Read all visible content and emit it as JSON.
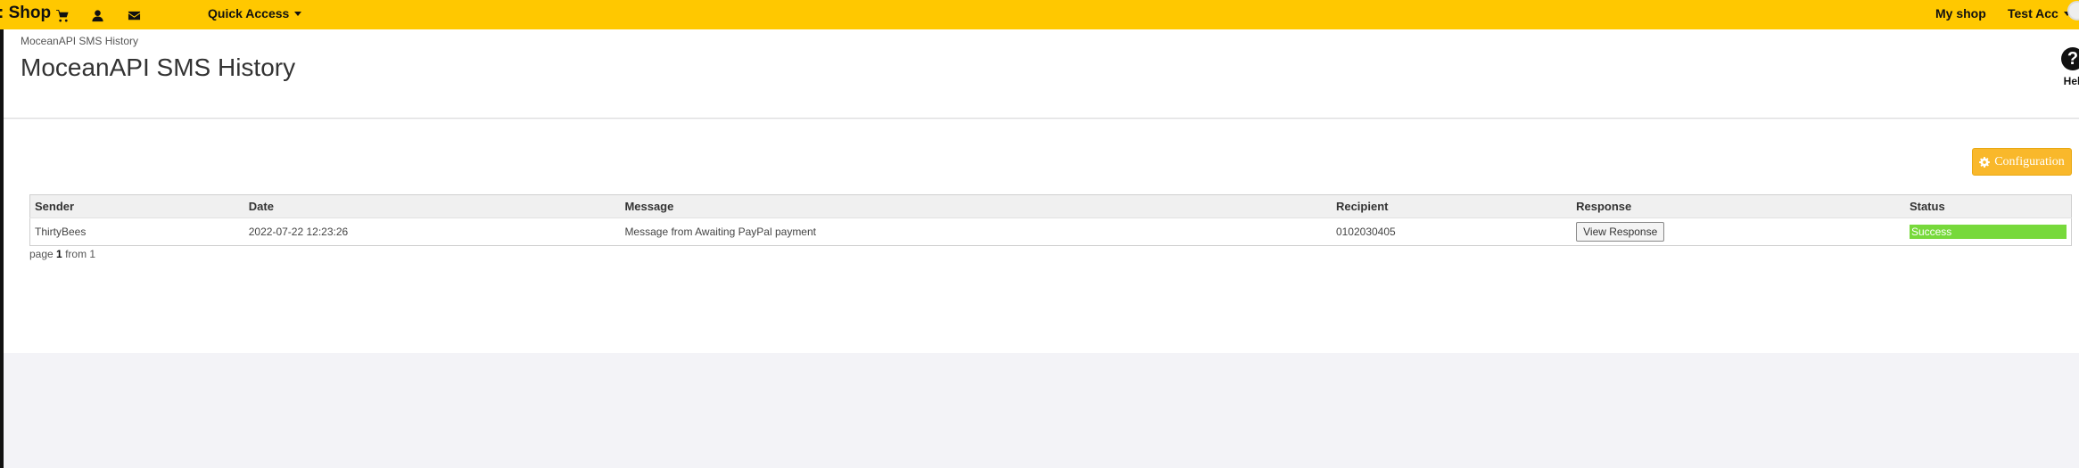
{
  "topbar": {
    "brand": ": Shop",
    "quick_access_label": "Quick Access",
    "my_shop_label": "My shop",
    "account_label": "Test Acc"
  },
  "icons": {
    "cart": "cart-icon",
    "user": "user-icon",
    "mail": "envelope-icon",
    "help": "question-circle-icon",
    "gear": "gear-icon"
  },
  "header": {
    "breadcrumb": "MoceanAPI SMS History",
    "title": "MoceanAPI SMS History",
    "help_label": "Hel",
    "help_glyph": "?"
  },
  "toolbar": {
    "configuration_label": "Configuration"
  },
  "table": {
    "columns": [
      "Sender",
      "Date",
      "Message",
      "Recipient",
      "Response",
      "Status"
    ],
    "rows": [
      {
        "sender": "ThirtyBees",
        "date": "2022-07-22 12:23:26",
        "message": "Message from Awaiting PayPal payment",
        "recipient": "0102030405",
        "response_button": "View Response",
        "status": "Success"
      }
    ]
  },
  "pagination": {
    "prefix": "page",
    "current": "1",
    "separator": "from",
    "total": "1"
  },
  "colors": {
    "topbar": "#ffc800",
    "config_button": "#f9b82b",
    "status_success": "#77d93b"
  }
}
